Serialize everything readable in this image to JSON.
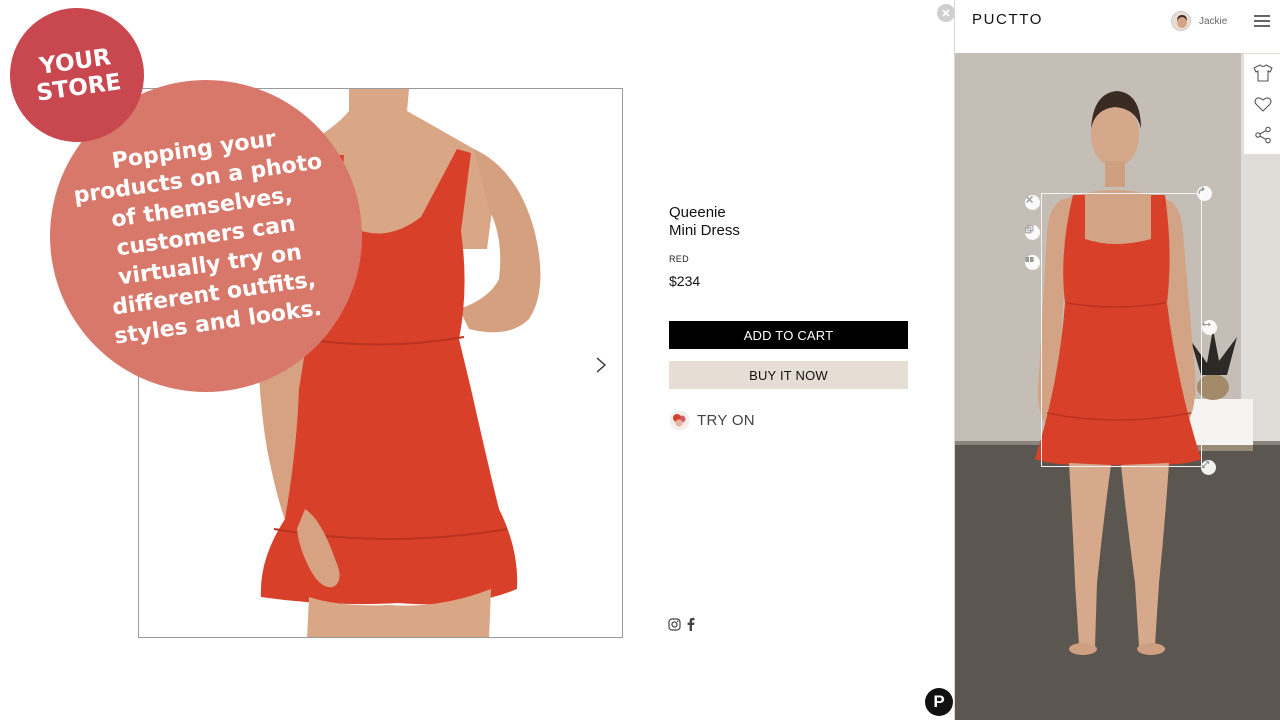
{
  "store": {
    "badge": {
      "line1": "YOUR",
      "line2": "STORE"
    },
    "callout": "Popping your products on a photo of themselves, customers can virtually try on different outfits, styles and looks.",
    "product": {
      "name_line1": "Queenie",
      "name_line2": "Mini Dress",
      "color": "RED",
      "price": "$234"
    },
    "buttons": {
      "add_to_cart": "ADD TO CART",
      "buy_it_now": "BUY IT NOW",
      "try_on": "TRY ON"
    },
    "icons": {
      "next": "chevron-right-icon",
      "close": "close-icon",
      "instagram": "instagram-icon",
      "facebook": "facebook-icon",
      "try_on": "try-on-icon"
    }
  },
  "fab": {
    "label": "P"
  },
  "panel": {
    "brand": "PUCTTO",
    "user": {
      "name": "Jackie"
    },
    "tools": [
      "shirt-icon",
      "heart-icon",
      "share-icon"
    ],
    "handles": [
      "remove-icon",
      "duplicate-icon",
      "flip-icon",
      "rotate-icon",
      "stretch-icon",
      "resize-icon"
    ]
  },
  "colors": {
    "dress": "#d8402a",
    "badge": "#c9474f",
    "callout": "#d8786b",
    "cart_button": "#000000",
    "buy_button": "#e6ded5"
  }
}
